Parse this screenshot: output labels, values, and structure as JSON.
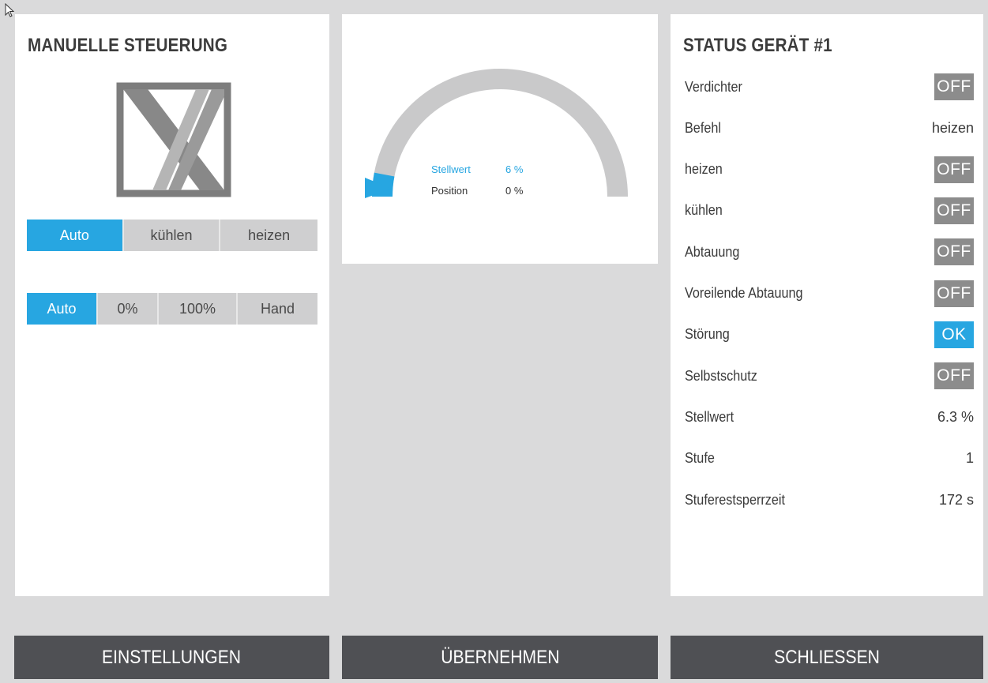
{
  "left_panel": {
    "title": "MANUELLE STEUERUNG",
    "icon": "valve-x-icon",
    "mode_options": [
      {
        "label": "Auto",
        "active": true
      },
      {
        "label": "kühlen",
        "active": false
      },
      {
        "label": "heizen",
        "active": false
      }
    ],
    "position_options": [
      {
        "label": "Auto",
        "active": true
      },
      {
        "label": "0%",
        "active": false
      },
      {
        "label": "100%",
        "active": false
      },
      {
        "label": "Hand",
        "active": false
      }
    ]
  },
  "gauge": {
    "setpoint_label": "Stellwert",
    "setpoint_value": "6 %",
    "setpoint_percent": 6,
    "position_label": "Position",
    "position_value": "0 %",
    "position_percent": 0
  },
  "status": {
    "title": "STATUS GERÄT #1",
    "rows": [
      {
        "label": "Verdichter",
        "value": "OFF",
        "kind": "badge"
      },
      {
        "label": "Befehl",
        "value": "heizen",
        "kind": "text"
      },
      {
        "label": "heizen",
        "value": "OFF",
        "kind": "badge"
      },
      {
        "label": "kühlen",
        "value": "OFF",
        "kind": "badge"
      },
      {
        "label": "Abtauung",
        "value": "OFF",
        "kind": "badge"
      },
      {
        "label": "Voreilende Abtauung",
        "value": "OFF",
        "kind": "badge"
      },
      {
        "label": "Störung",
        "value": "OK",
        "kind": "badge-ok"
      },
      {
        "label": "Selbstschutz",
        "value": "OFF",
        "kind": "badge"
      },
      {
        "label": "Stellwert",
        "value": "6.3 %",
        "kind": "text"
      },
      {
        "label": "Stufe",
        "value": "1",
        "kind": "text"
      },
      {
        "label": "Stuferestsperrzeit",
        "value": "172 s",
        "kind": "text"
      }
    ]
  },
  "buttons": {
    "settings": "EINSTELLUNGEN",
    "apply": "ÜBERNEHMEN",
    "close": "SCHLIESSEN"
  },
  "colors": {
    "accent": "#27a6e1",
    "badge_off": "#8c8c8c",
    "button_dark": "#4f5054",
    "background": "#dadadb"
  }
}
